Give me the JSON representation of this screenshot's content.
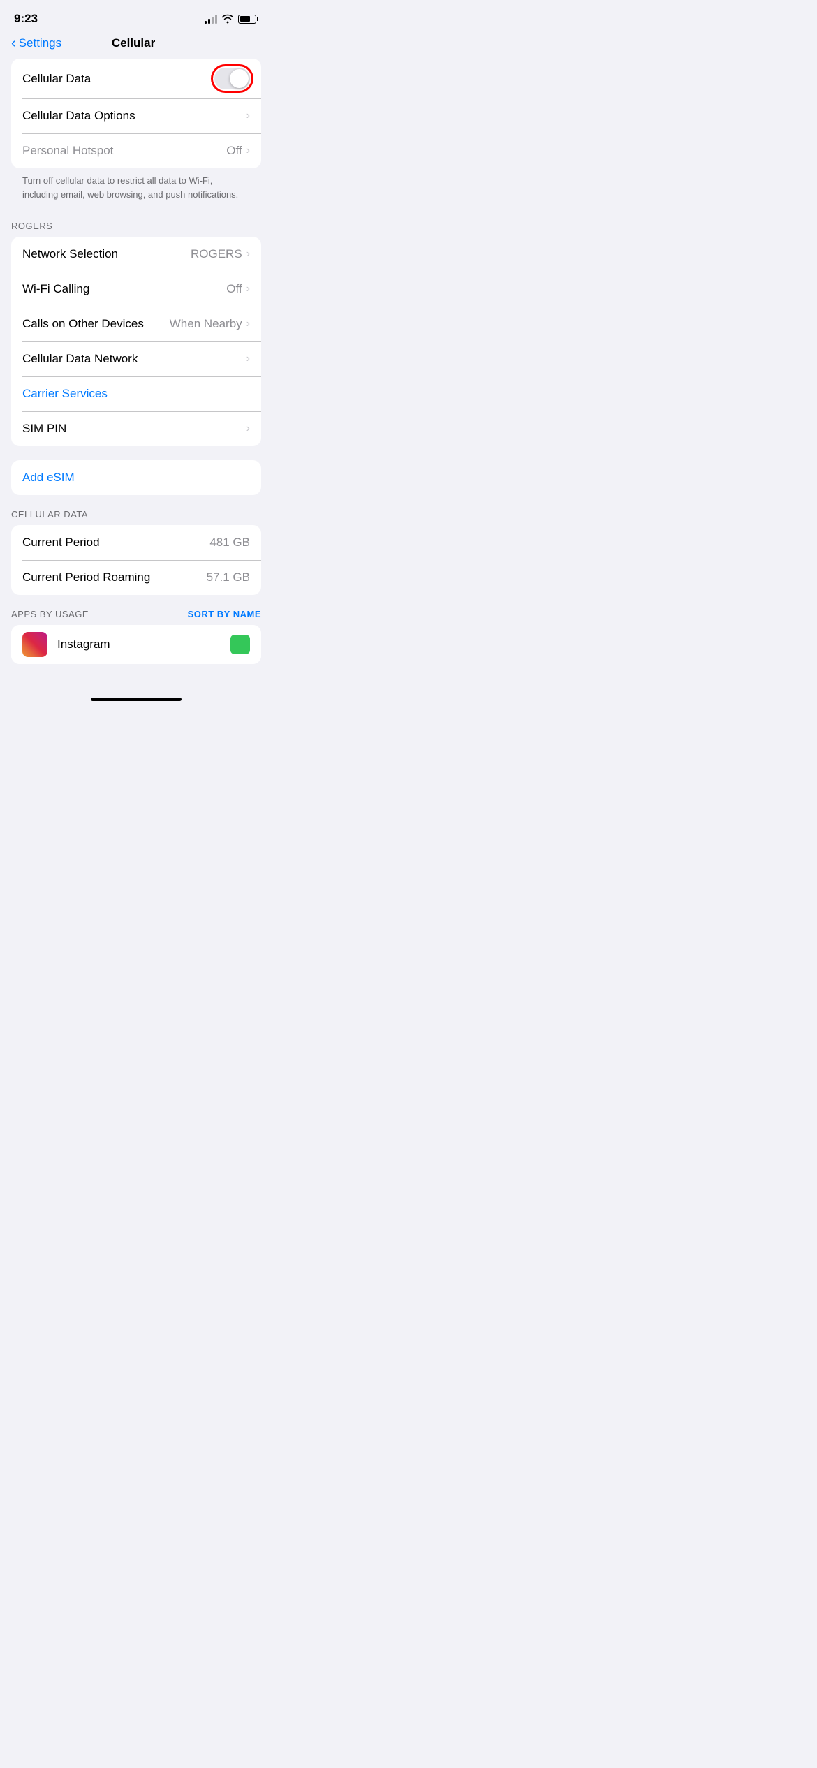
{
  "statusBar": {
    "time": "9:23",
    "signalBars": [
      true,
      true,
      false,
      false
    ],
    "battery": "70%"
  },
  "header": {
    "backLabel": "Settings",
    "title": "Cellular"
  },
  "topSection": {
    "rows": [
      {
        "label": "Cellular Data",
        "type": "toggle",
        "toggleOn": false,
        "highlighted": true
      },
      {
        "label": "Cellular Data Options",
        "type": "chevron",
        "value": ""
      },
      {
        "label": "Personal Hotspot",
        "type": "chevron-value",
        "value": "Off",
        "labelGray": true
      }
    ],
    "description": "Turn off cellular data to restrict all data to Wi-Fi, including email, web browsing, and push notifications."
  },
  "rogersSection": {
    "header": "ROGERS",
    "rows": [
      {
        "label": "Network Selection",
        "type": "chevron-value",
        "value": "ROGERS"
      },
      {
        "label": "Wi-Fi Calling",
        "type": "chevron-value",
        "value": "Off"
      },
      {
        "label": "Calls on Other Devices",
        "type": "chevron-value",
        "value": "When Nearby"
      },
      {
        "label": "Cellular Data Network",
        "type": "chevron",
        "value": ""
      },
      {
        "label": "Carrier Services",
        "type": "link",
        "value": ""
      },
      {
        "label": "SIM PIN",
        "type": "chevron",
        "value": ""
      }
    ]
  },
  "esimSection": {
    "label": "Add eSIM"
  },
  "cellularDataSection": {
    "header": "CELLULAR DATA",
    "rows": [
      {
        "label": "Current Period",
        "type": "value",
        "value": "481 GB"
      },
      {
        "label": "Current Period Roaming",
        "type": "value",
        "value": "57.1 GB"
      }
    ],
    "appsHeader": "APPS BY USAGE",
    "sortLabel": "SORT BY NAME"
  },
  "appRow": {
    "name": "Instagram",
    "iconType": "instagram"
  }
}
